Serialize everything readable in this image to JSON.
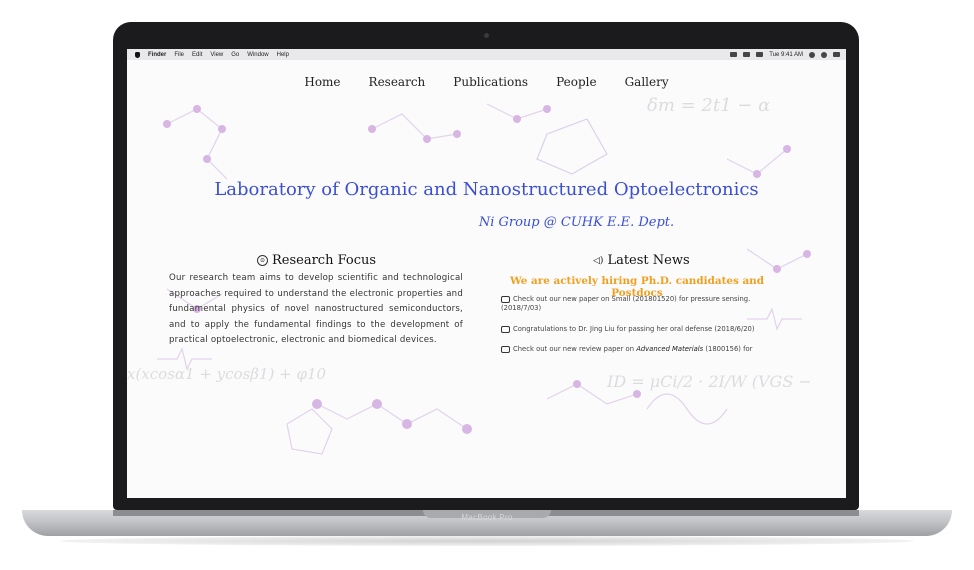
{
  "device": {
    "brand": "MacBook Pro"
  },
  "menubar": {
    "app": "Finder",
    "items": [
      "File",
      "Edit",
      "View",
      "Go",
      "Window",
      "Help"
    ],
    "clock": "Tue 9:41 AM"
  },
  "nav": {
    "items": [
      "Home",
      "Research",
      "Publications",
      "People",
      "Gallery"
    ]
  },
  "hero": {
    "title": "Laboratory of Organic and Nanostructured Optoelectronics",
    "subtitle": "Ni Group @ CUHK E.E. Dept."
  },
  "research_focus": {
    "heading": "Research Focus",
    "text": "Our research team aims to develop scientific and technological approaches required to understand the electronic properties and fundamental physics of novel nanostructured semiconductors, and to apply the fundamental findings to the development of practical optoelectronic, electronic and biomedical devices."
  },
  "latest_news": {
    "heading": "Latest News",
    "hiring": "We are actively hiring Ph.D. candidates and Postdocs",
    "items": [
      {
        "text": "Check out our new paper on Small (201801520) for pressure sensing. (2018/7/03)"
      },
      {
        "text": "Congratulations to Dr. Jing Liu for passing her oral defense (2018/6/20)"
      },
      {
        "prefix": "Check out our new review paper on ",
        "emph": "Advanced Materials",
        "suffix": " (1800156) for"
      }
    ]
  },
  "background_equations": {
    "top_right": "δm = 2t1 − α",
    "bottom_left": "x(xcosα1 + ycosβ1) + φ10",
    "bottom_right": "ID = μCi/2 · 2I/W (VGS −"
  },
  "colors": {
    "accent_blue": "#3a4fd6",
    "hiring_orange": "#f0a020",
    "molecule_purple": "#c9a3d9"
  }
}
